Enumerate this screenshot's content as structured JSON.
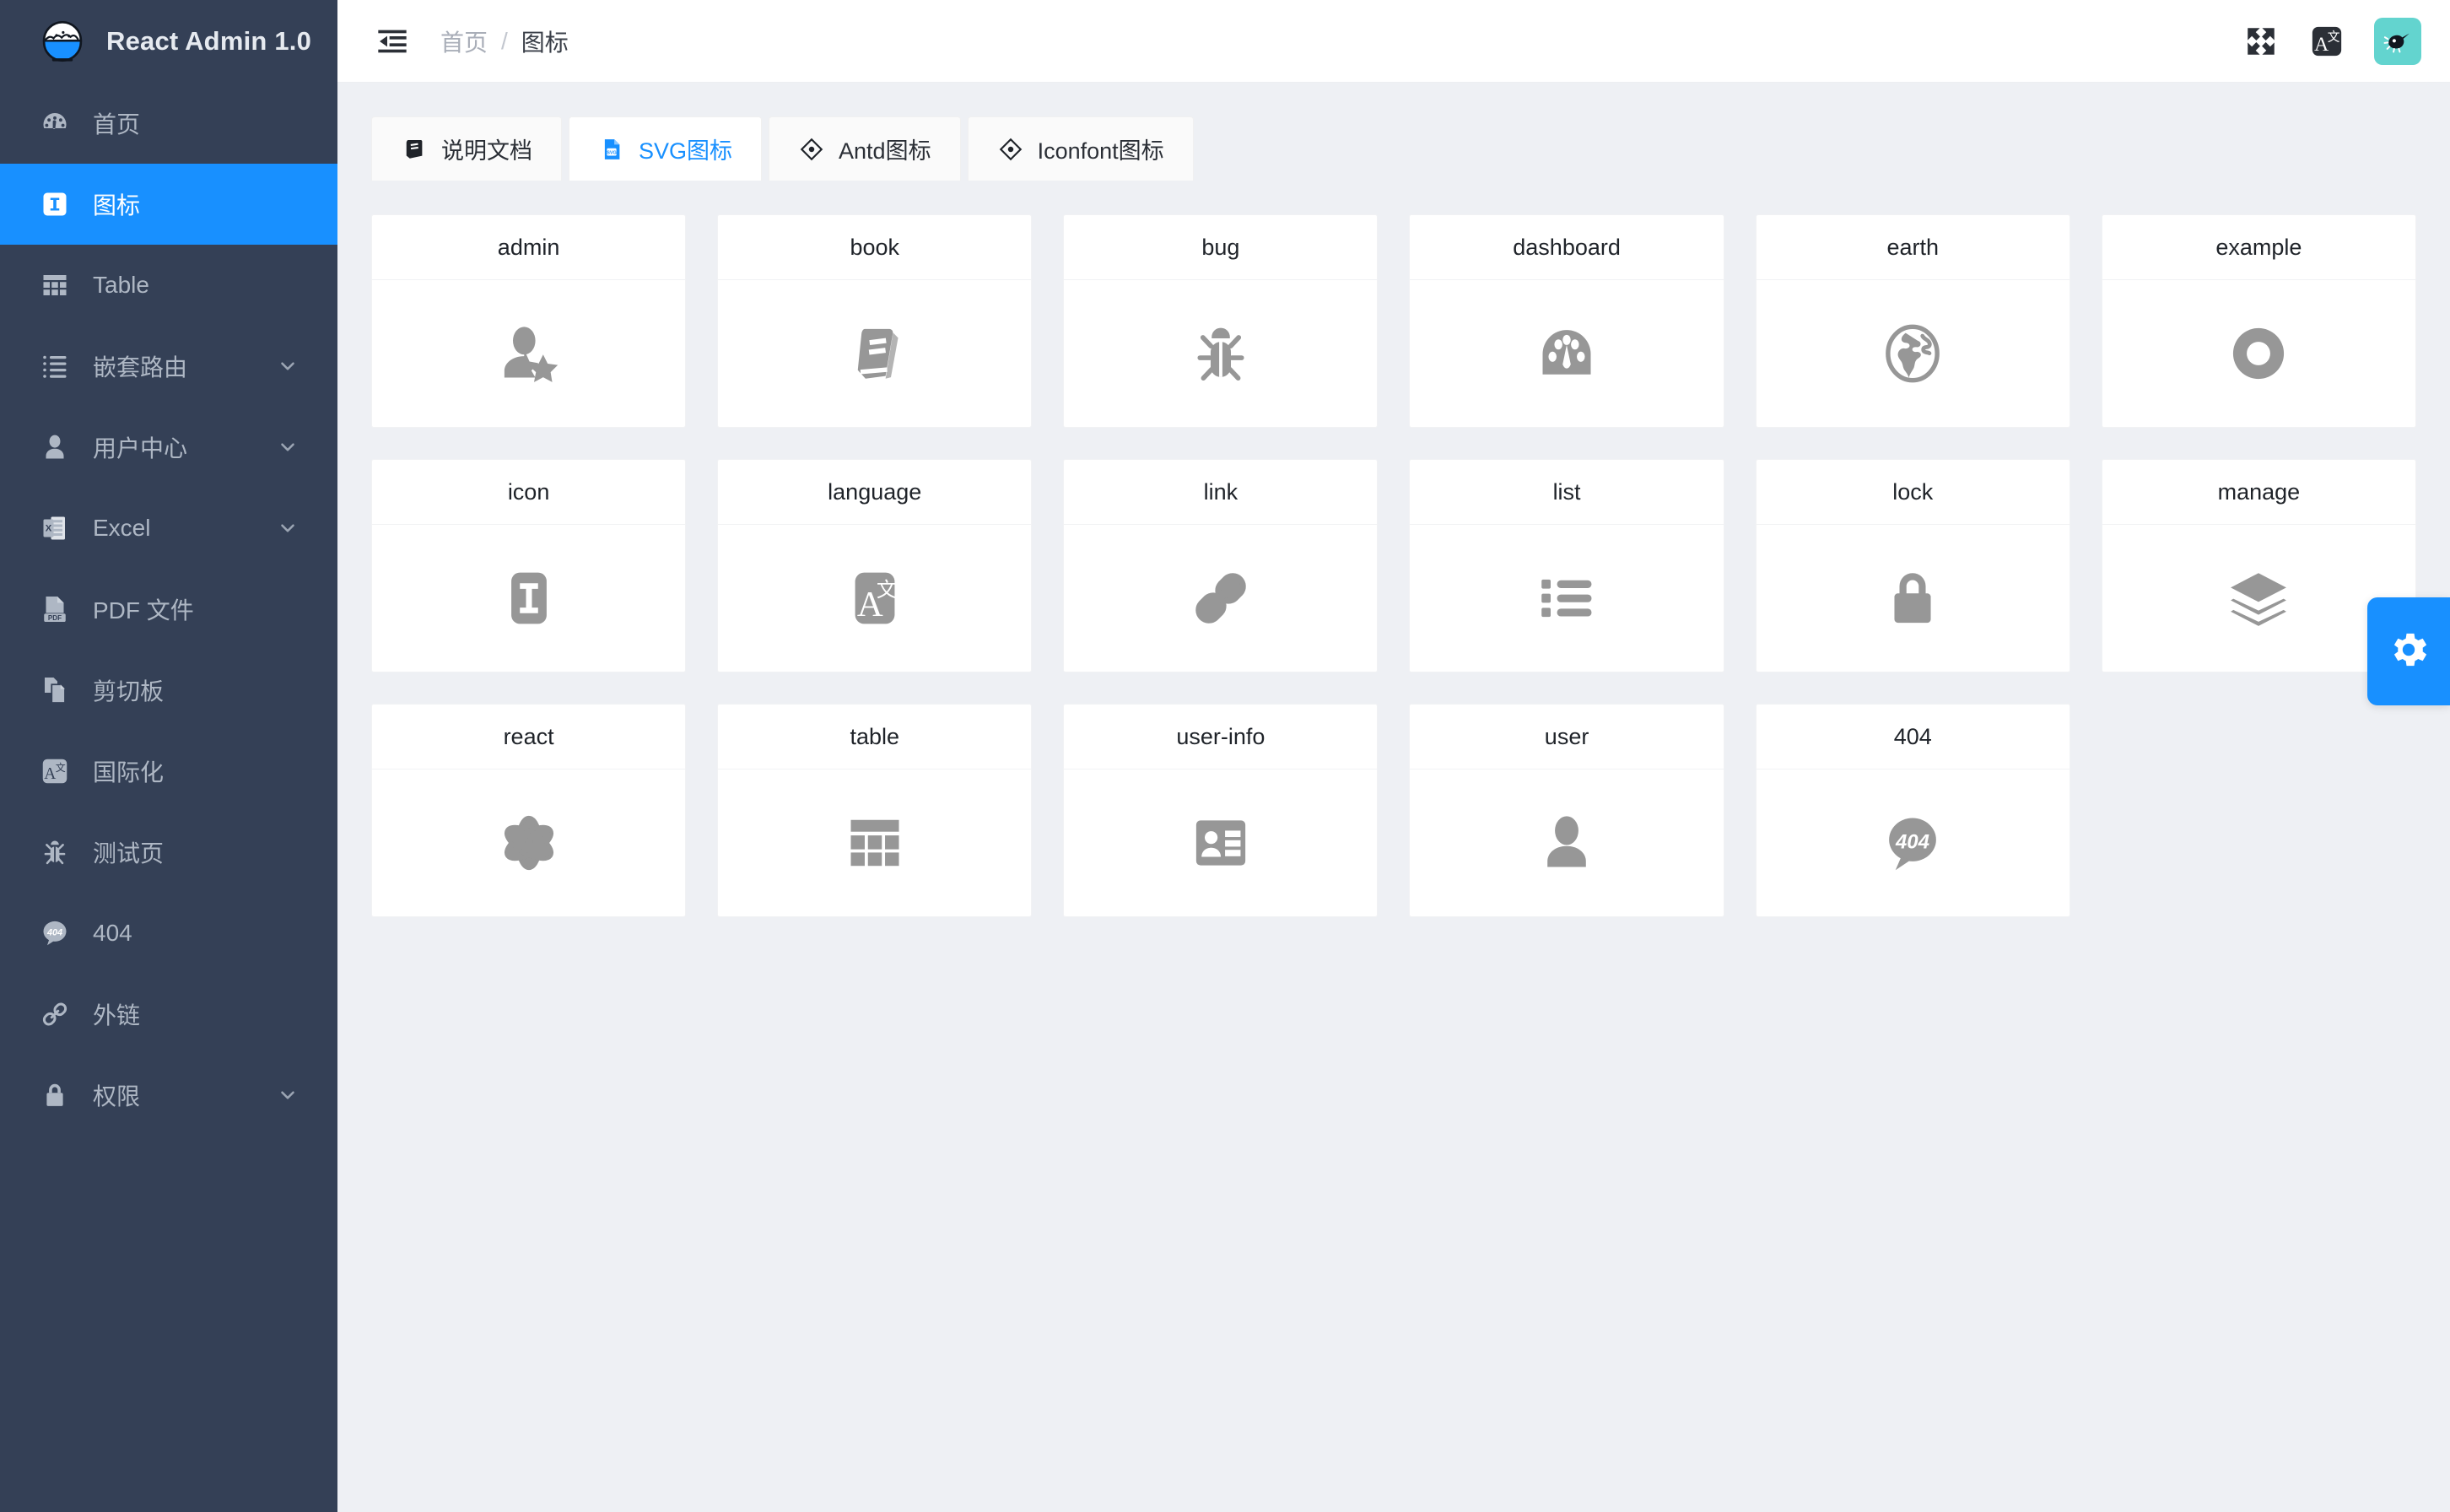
{
  "app": {
    "brand_title": "React Admin 1.0",
    "logo_icon": "rice-bowl-icon"
  },
  "sidebar": {
    "items": [
      {
        "label": "首页",
        "icon": "dashboard-icon",
        "active": false,
        "expandable": false
      },
      {
        "label": "图标",
        "icon": "icon-badge-icon",
        "active": true,
        "expandable": false
      },
      {
        "label": "Table",
        "icon": "table-icon",
        "active": false,
        "expandable": false
      },
      {
        "label": "嵌套路由",
        "icon": "list-nested-icon",
        "active": false,
        "expandable": true
      },
      {
        "label": "用户中心",
        "icon": "user-icon",
        "active": false,
        "expandable": true
      },
      {
        "label": "Excel",
        "icon": "excel-file-icon",
        "active": false,
        "expandable": true
      },
      {
        "label": "PDF 文件",
        "icon": "pdf-file-icon",
        "active": false,
        "expandable": false
      },
      {
        "label": "剪切板",
        "icon": "clipboard-copy-icon",
        "active": false,
        "expandable": false
      },
      {
        "label": "国际化",
        "icon": "translate-icon",
        "active": false,
        "expandable": false
      },
      {
        "label": "测试页",
        "icon": "bug-icon",
        "active": false,
        "expandable": false
      },
      {
        "label": "404",
        "icon": "404-icon",
        "active": false,
        "expandable": false
      },
      {
        "label": "外链",
        "icon": "link-icon",
        "active": false,
        "expandable": false
      },
      {
        "label": "权限",
        "icon": "lock-icon",
        "active": false,
        "expandable": true
      }
    ]
  },
  "topbar": {
    "fold_icon": "menu-fold-icon",
    "breadcrumb": {
      "home": "首页",
      "separator": "/",
      "current": "图标"
    },
    "fullscreen_icon": "fullscreen-icon",
    "language_icon": "translate-icon",
    "avatar_icon": "avatar-icon"
  },
  "tabs": [
    {
      "label": "说明文档",
      "icon": "book-icon",
      "active": false
    },
    {
      "label": "SVG图标",
      "icon": "svg-file-icon",
      "active": true
    },
    {
      "label": "Antd图标",
      "icon": "diamond-icon",
      "active": false
    },
    {
      "label": "Iconfont图标",
      "icon": "diamond-icon",
      "active": false
    }
  ],
  "icons": [
    {
      "label": "admin",
      "icon": "user-star-icon"
    },
    {
      "label": "book",
      "icon": "book-icon"
    },
    {
      "label": "bug",
      "icon": "bug-icon"
    },
    {
      "label": "dashboard",
      "icon": "dashboard-icon"
    },
    {
      "label": "earth",
      "icon": "globe-icon"
    },
    {
      "label": "example",
      "icon": "lifebuoy-icon"
    },
    {
      "label": "icon",
      "icon": "letter-i-icon"
    },
    {
      "label": "language",
      "icon": "translate-icon"
    },
    {
      "label": "link",
      "icon": "link-icon"
    },
    {
      "label": "list",
      "icon": "list-icon"
    },
    {
      "label": "lock",
      "icon": "lock-icon"
    },
    {
      "label": "manage",
      "icon": "layers-icon"
    },
    {
      "label": "react",
      "icon": "react-atom-icon"
    },
    {
      "label": "table",
      "icon": "table-icon"
    },
    {
      "label": "user-info",
      "icon": "id-card-icon"
    },
    {
      "label": "user",
      "icon": "user-icon"
    },
    {
      "label": "404",
      "icon": "404-icon"
    }
  ],
  "settings_fab": {
    "icon": "gear-icon"
  },
  "colors": {
    "sidebar_bg": "#344056",
    "accent": "#1890ff",
    "content_bg": "#eef0f4",
    "card_bg": "#ffffff",
    "icon_gray": "#979797",
    "avatar_bg": "#63d4cf"
  }
}
